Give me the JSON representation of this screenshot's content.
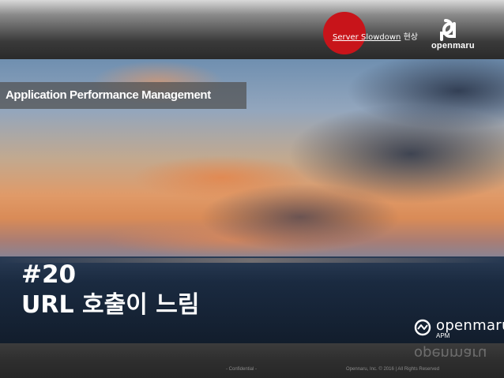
{
  "header": {
    "subject_part1": "Server Slowdown",
    "subject_part2": "현상",
    "brand_logo_text": "openmaru"
  },
  "section": {
    "label": "Application Performance Management"
  },
  "slide": {
    "number": "#20",
    "title": "URL 호출이 느림"
  },
  "product_logo": {
    "brand": "openmaru",
    "product": "APM"
  },
  "footer": {
    "confidential": "- Confidential -",
    "copyright": "Opennaru, Inc. ©  2016 | All Rights Reserved"
  },
  "colors": {
    "accent_red": "#c8141a",
    "text_white": "#ffffff"
  }
}
